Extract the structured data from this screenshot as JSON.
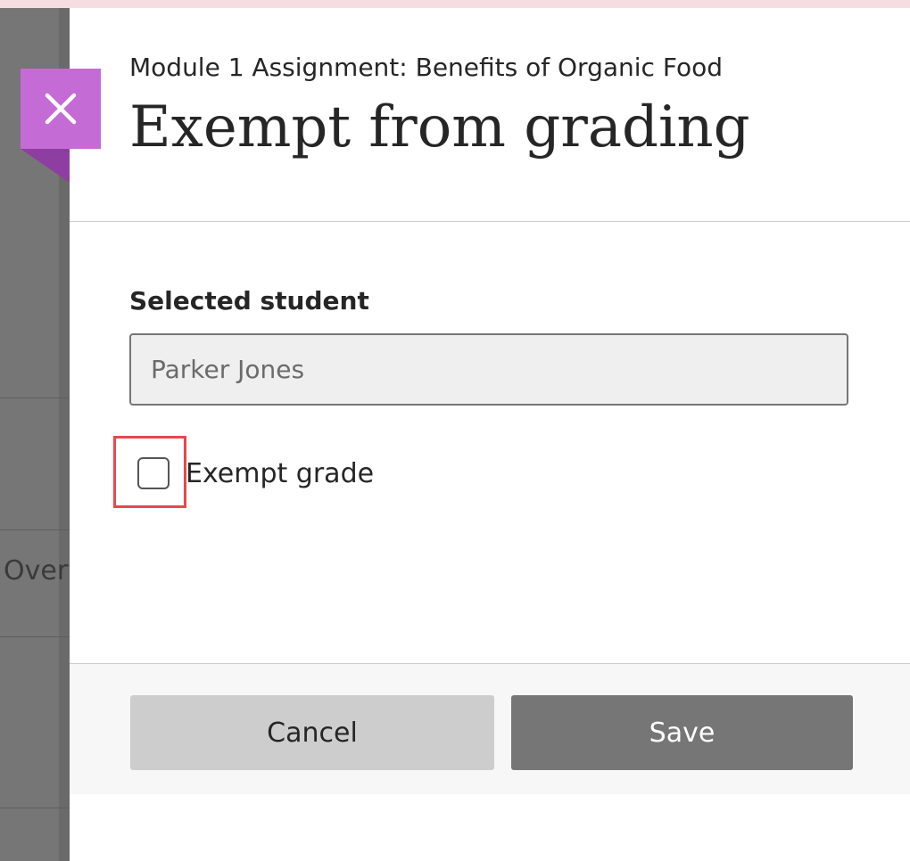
{
  "panel": {
    "subtitle": "Module 1 Assignment: Benefits of Organic Food",
    "title": "Exempt from grading"
  },
  "form": {
    "student_label": "Selected student",
    "student_value": "Parker Jones",
    "exempt_checkbox_label": "Exempt grade",
    "exempt_checked": false
  },
  "buttons": {
    "cancel_label": "Cancel",
    "save_label": "Save"
  },
  "backdrop": {
    "partial_text": "Overv"
  },
  "icons": {
    "close": "close-icon"
  },
  "colors": {
    "close_tab": "#c56bd6",
    "close_tab_fold": "#8e3ea0",
    "highlight": "#e8474e",
    "save_button": "#767676",
    "cancel_button": "#cdcdcd"
  }
}
